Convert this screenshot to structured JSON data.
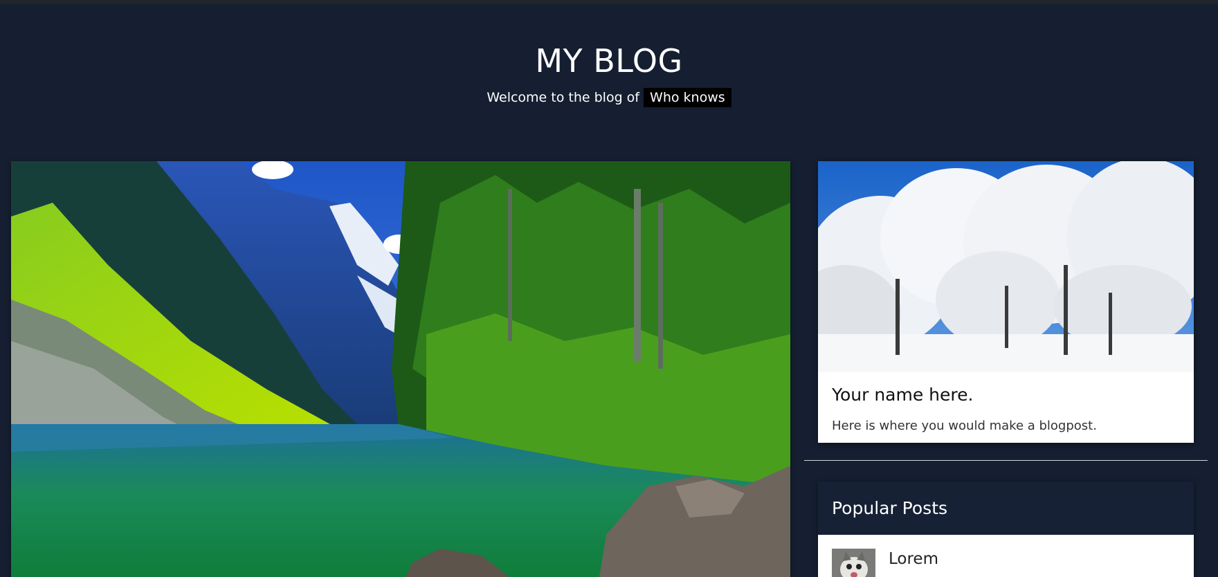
{
  "header": {
    "title": "MY BLOG",
    "tagline_prefix": "Welcome to the blog of",
    "tagline_name": "Who knows"
  },
  "hero": {
    "image_description": "mountain-lake-forest-landscape"
  },
  "sidebar": {
    "card": {
      "title": "Your name here.",
      "text": "Here is where you would make a blogpost."
    },
    "popular_posts": {
      "title": "Popular Posts",
      "items": [
        {
          "label": "Lorem"
        }
      ]
    }
  },
  "colors": {
    "background": "#151f31",
    "card_background": "#ffffff",
    "highlight_background": "#000000",
    "text_light": "#ffffff"
  }
}
